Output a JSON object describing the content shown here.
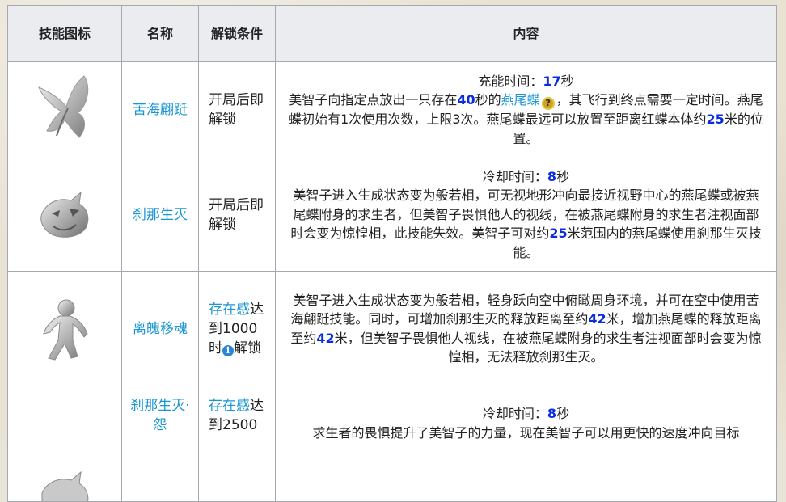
{
  "table": {
    "headers": [
      "技能图标",
      "名称",
      "解锁条件",
      "内容"
    ],
    "rows": [
      {
        "name": "苦海翩跹",
        "condition": "开局后即解锁",
        "timer_label": "充能时间：",
        "timer_value": "17",
        "timer_unit": "秒",
        "content": {
          "p1": "美智子向指定点放出一只存在",
          "n1": "40",
          "p2": "秒的",
          "link": "燕尾蝶",
          "p3": "，其飞行到终点需要一定时间。燕尾蝶初始有1次使用次数，上限3次。燕尾蝶最远可以放置至距离红蝶本体约",
          "n2": "25",
          "p4": "米的位置。"
        }
      },
      {
        "name": "刹那生灭",
        "condition": "开局后即解锁",
        "timer_label": "冷却时间：",
        "timer_value": "8",
        "timer_unit": "秒",
        "content": {
          "p1": "美智子进入生成状态变为般若相，可无视地形冲向最接近视野中心的燕尾蝶或被燕尾蝶附身的求生者，但美智子畏惧他人的视线，在被燕尾蝶附身的求生者注视面部时会变为惊惶相，此技能失效。美智子可对约",
          "n1": "25",
          "p2": "米范围内的燕尾蝶使用刹那生灭技能。"
        }
      },
      {
        "name": "离魄移魂",
        "condition": {
          "link": "存在感",
          "text1": "达到1000时",
          "text2": "解锁"
        },
        "content": {
          "p1": "美智子进入生成状态变为般若相，轻身跃向空中俯瞰周身环境，并可在空中使用苦海翩跹技能。同时，可增加刹那生灭的释放距离至约",
          "n1": "42",
          "p2": "米，增加燕尾蝶的释放距离至约",
          "n2": "42",
          "p3": "米，但美智子畏惧他人视线，在被燕尾蝶附身的求生者注视面部时会变为惊惶相，无法释放刹那生灭。"
        }
      },
      {
        "name": "刹那生灭·怨",
        "condition": {
          "link": "存在感",
          "text1": "达到2500"
        },
        "timer_label": "冷却时间：",
        "timer_value": "8",
        "timer_unit": "秒",
        "content": {
          "p1": "求生者的畏惧提升了美智子的力量，现在美智子可以用更快的速度冲向目标"
        }
      }
    ]
  },
  "icons": {
    "help": "?",
    "info": "i"
  },
  "colors": {
    "link": "#1a96d4",
    "number": "#0a2be0",
    "header_bg": "#eaecf0",
    "border": "#a2a9b1"
  }
}
